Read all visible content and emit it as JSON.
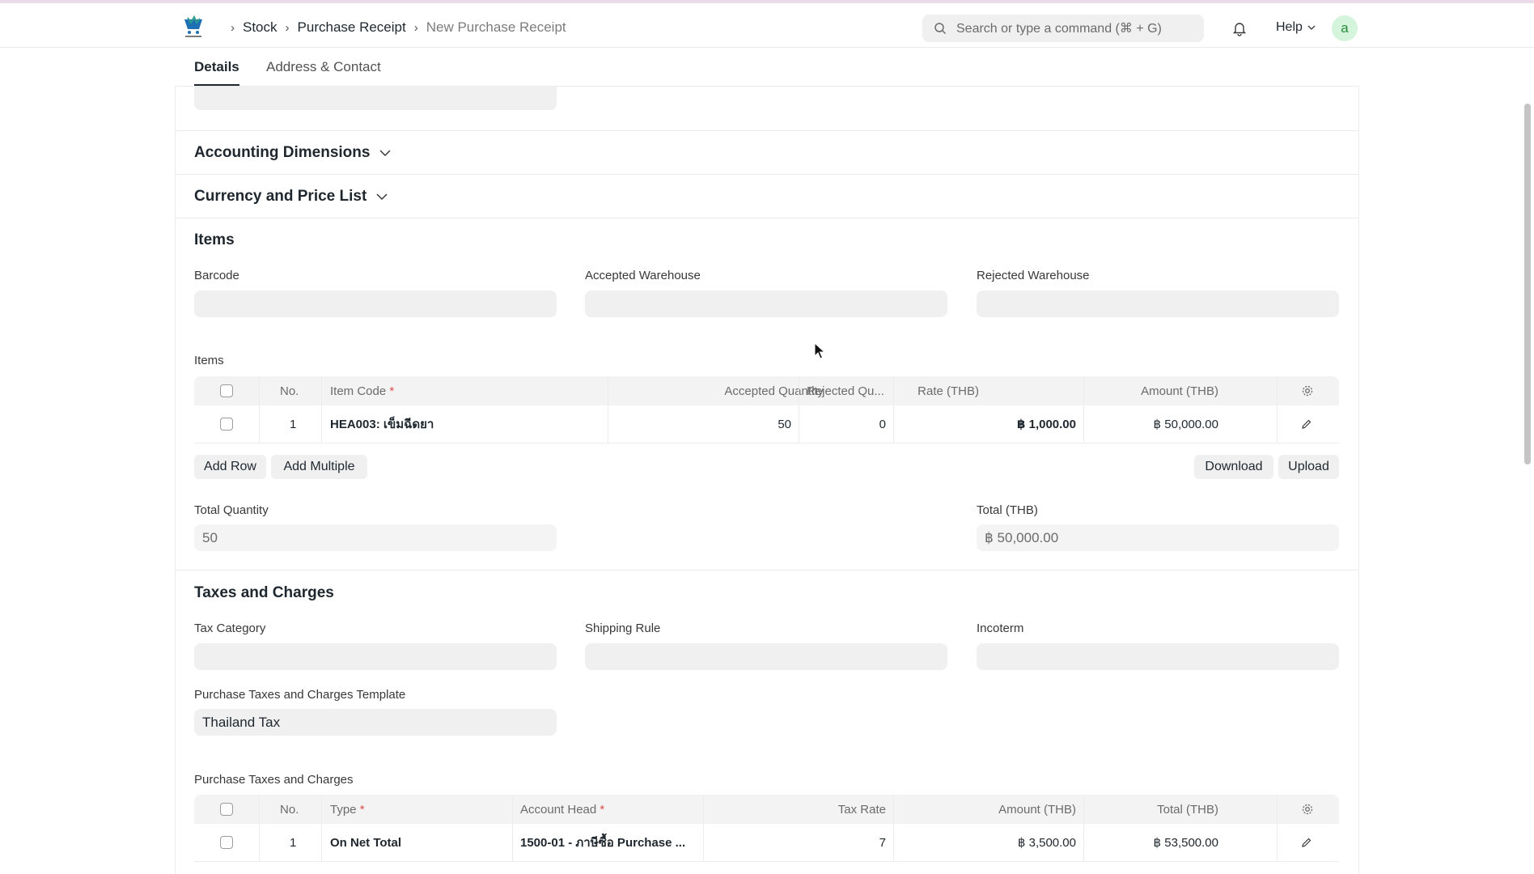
{
  "breadcrumb": {
    "items": [
      "Stock",
      "Purchase Receipt"
    ],
    "current": "New Purchase Receipt"
  },
  "search": {
    "placeholder": "Search or type a command (⌘ + G)"
  },
  "help_label": "Help",
  "avatar_letter": "a",
  "tabs": [
    {
      "label": "Details",
      "active": true
    },
    {
      "label": "Address & Contact",
      "active": false
    }
  ],
  "sections": {
    "accounting_dimensions": "Accounting Dimensions",
    "currency_price_list": "Currency and Price List",
    "items": "Items",
    "taxes_charges": "Taxes and Charges"
  },
  "items_section": {
    "barcode_label": "Barcode",
    "accepted_warehouse_label": "Accepted Warehouse",
    "rejected_warehouse_label": "Rejected Warehouse",
    "table_label": "Items",
    "columns": {
      "no": "No.",
      "item_code": "Item Code",
      "accepted_qty": "Accepted Quantity",
      "rejected_qty": "Rejected Qu...",
      "rate": "Rate (THB)",
      "amount": "Amount (THB)"
    },
    "rows": [
      {
        "no": "1",
        "item_code": "HEA003: เข็มฉีดยา",
        "accepted_qty": "50",
        "rejected_qty": "0",
        "rate": "฿ 1,000.00",
        "amount": "฿ 50,000.00"
      }
    ],
    "buttons": {
      "add_row": "Add Row",
      "add_multiple": "Add Multiple",
      "download": "Download",
      "upload": "Upload"
    },
    "total_quantity_label": "Total Quantity",
    "total_quantity_value": "50",
    "total_label": "Total (THB)",
    "total_value": "฿ 50,000.00"
  },
  "taxes_section": {
    "tax_category_label": "Tax Category",
    "shipping_rule_label": "Shipping Rule",
    "incoterm_label": "Incoterm",
    "template_label": "Purchase Taxes and Charges Template",
    "template_value": "Thailand Tax",
    "table_label": "Purchase Taxes and Charges",
    "columns": {
      "no": "No.",
      "type": "Type",
      "account_head": "Account Head",
      "tax_rate": "Tax Rate",
      "amount": "Amount (THB)",
      "total": "Total (THB)"
    },
    "rows": [
      {
        "no": "1",
        "type": "On Net Total",
        "account_head": "1500-01 - ภาษีซื้อ Purchase ...",
        "tax_rate": "7",
        "amount": "฿ 3,500.00",
        "total": "฿ 53,500.00"
      }
    ]
  },
  "colors": {
    "primary_text": "#1f272e",
    "muted_text": "#6b6b6b",
    "field_bg": "#f0f0f0",
    "required": "#e24c4c",
    "avatar_bg": "#d5f4dc"
  }
}
